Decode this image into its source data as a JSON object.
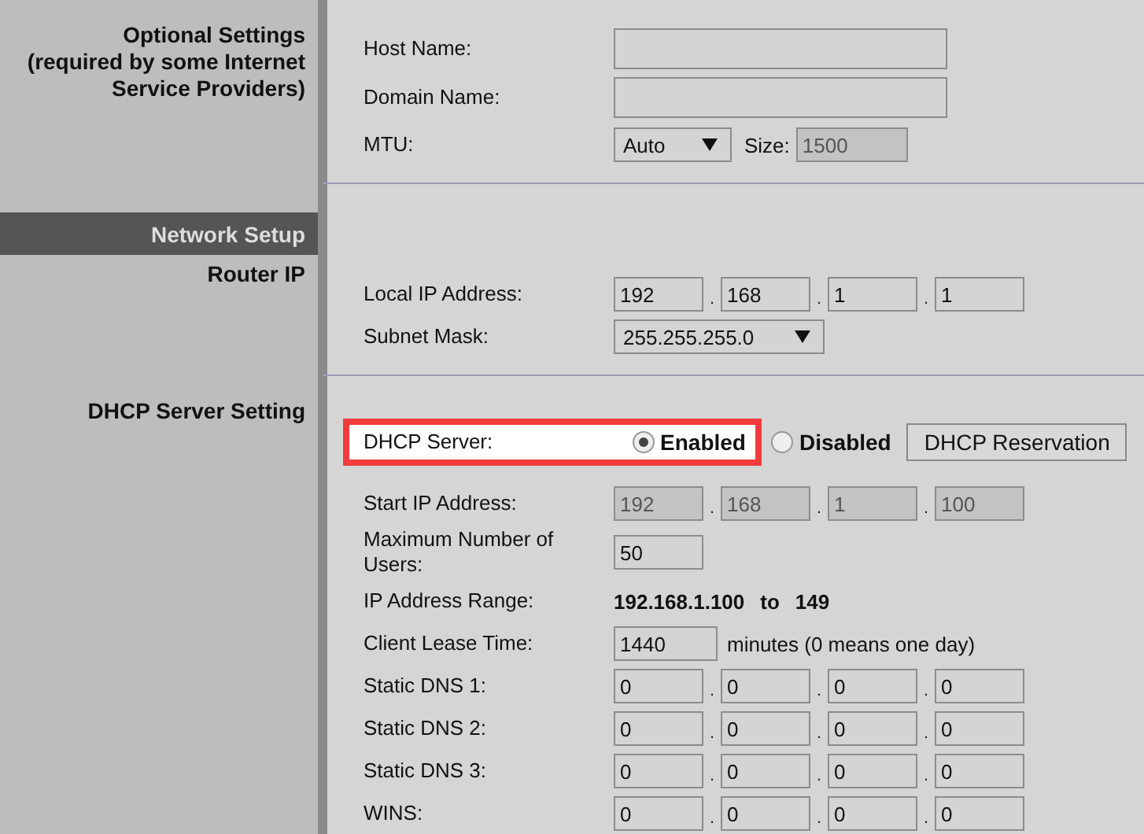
{
  "groups": [
    {
      "heading": "Optional Settings\n(required by some Internet\nService Providers)",
      "rows": [
        {
          "kind": "text",
          "label": "Host Name:"
        },
        {
          "kind": "text",
          "label": "Domain Name:"
        },
        {
          "kind": "mtu",
          "label": "MTU:",
          "value": "Auto",
          "size_label": "Size:",
          "size_value": "1500",
          "size_disabled": true
        }
      ]
    },
    {
      "banner": "Network Setup",
      "heading": "Router IP",
      "rows": [
        {
          "kind": "ip",
          "label": "Local IP Address:",
          "octets": [
            "192",
            "168",
            "1",
            "1"
          ],
          "separators": [
            ".",
            ".",
            "."
          ],
          "disabled": false
        },
        {
          "kind": "select",
          "label": "Subnet Mask:",
          "value": "255.255.255.0"
        }
      ]
    },
    {
      "heading": "DHCP Server Setting",
      "rows": [
        {
          "kind": "radio",
          "label": "DHCP Server:",
          "highlighted": true,
          "options": [
            {
              "label": "Enabled",
              "selected": true
            },
            {
              "label": "Disabled",
              "selected": false
            }
          ],
          "button": "DHCP Reservation"
        },
        {
          "kind": "ip",
          "label": "Start IP Address:",
          "octets": [
            "192",
            "168",
            "1",
            "100"
          ],
          "separators": [
            ".",
            ".",
            "."
          ],
          "disabled": true
        },
        {
          "kind": "text",
          "label": "Maximum Number of Users:",
          "value": "50"
        },
        {
          "kind": "range",
          "label": "IP Address Range:",
          "from": "192.168.1.100",
          "to_word": "to",
          "to": "149"
        },
        {
          "kind": "text",
          "label": "Client Lease Time:",
          "value": "1440",
          "suffix": "minutes (0 means one day)"
        },
        {
          "kind": "ip",
          "label": "Static DNS 1:",
          "octets": [
            "0",
            "0",
            "0",
            "0"
          ],
          "separators": [
            ".",
            ".",
            "."
          ],
          "disabled": false
        },
        {
          "kind": "ip",
          "label": "Static DNS 2:",
          "octets": [
            "0",
            "0",
            "0",
            "0"
          ],
          "separators": [
            ".",
            ".",
            "."
          ],
          "disabled": false
        },
        {
          "kind": "ip",
          "label": "Static DNS 3:",
          "octets": [
            "0",
            "0",
            "0",
            "0"
          ],
          "separators": [
            ".",
            ".",
            "."
          ],
          "disabled": false
        },
        {
          "kind": "ip",
          "label": "WINS:",
          "octets": [
            "0",
            "0",
            "0",
            "0"
          ],
          "separators": [
            ".",
            ".",
            "."
          ],
          "disabled": false
        }
      ]
    }
  ]
}
